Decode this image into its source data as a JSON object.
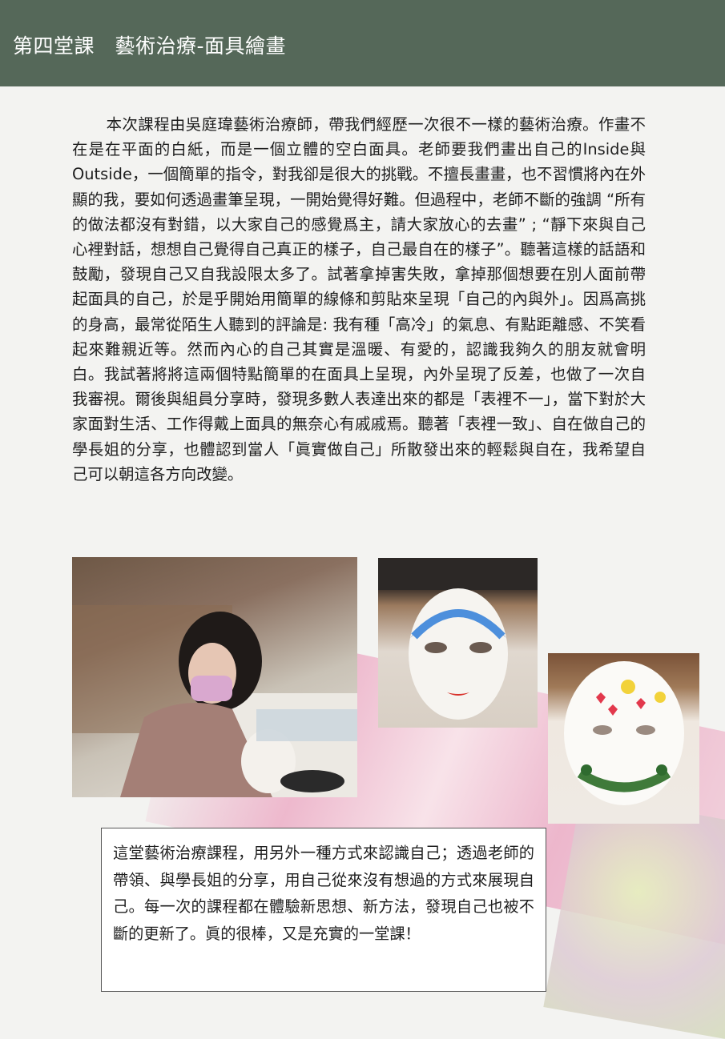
{
  "header": {
    "title": "第四堂課　藝術治療-面具繪畫"
  },
  "article": {
    "paragraph": "本次課程由吳庭瑋藝術治療師，帶我們經歷一次很不一樣的藝術治療。作畫不在是在平面的白紙，而是一個立體的空白面具。老師要我們畫出自己的Inside與Outside，一個簡單的指令，對我卻是很大的挑戰。不擅長畫畫，也不習慣將內在外顯的我，要如何透過畫筆呈現，一開始覺得好難。但過程中，老師不斷的強調 “所有的做法都沒有對錯，以大家自己的感覺爲主，請大家放心的去畫” ; “靜下來與自己心裡對話，想想自己覺得自己真正的樣子，自己最自在的樣子”。聽著這樣的話語和鼓勵，發現自己又自我設限太多了。試著拿掉害失敗，拿掉那個想要在別人面前帶起面具的自己，於是乎開始用簡單的線條和剪貼來呈現「自己的內與外」。因爲高挑的身高，最常從陌生人聽到的評論是: 我有種「高冷」的氣息、有點距離感、不笑看起來難親近等。然而內心的自己其實是溫暖、有愛的，認識我夠久的朋友就會明白。我試著將將這兩個特點簡單的在面具上呈現，內外呈現了反差，也做了一次自我審視。爾後與組員分享時，發現多數人表達出來的都是「表裡不一」，當下對於大家面對生活、工作得戴上面具的無奈心有戚戚焉。聽著「表裡一致」、自在做自己的學長姐的分享，也體認到當人「眞實做自己」所散發出來的輕鬆與自在，我希望自己可以朝這各方向改變。"
  },
  "photos": {
    "student": "student-drawing-mask-photo",
    "mask_blue": "blue-top-mask-photo",
    "mask_hearts": "hearts-and-leaves-mask-photo"
  },
  "summary_box": {
    "text": "這堂藝術治療課程，用另外一種方式來認識自己；透過老師的帶領、與學長姐的分享，用自己從來沒有想過的方式來展現自己。每一次的課程都在體驗新思想、新方法，發現自己也被不斷的更新了。眞的很棒，又是充實的一堂課！"
  },
  "colors": {
    "header_bg": "#556859",
    "page_bg": "#f3f3f1"
  }
}
